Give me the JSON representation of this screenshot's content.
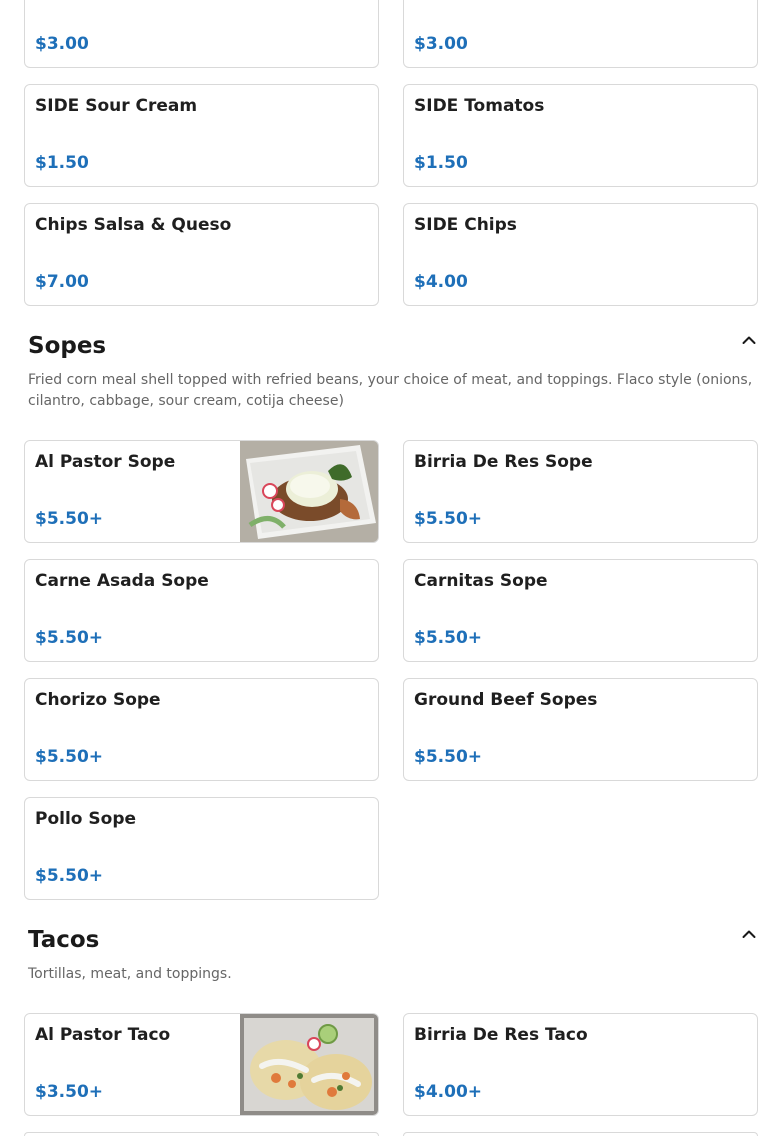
{
  "top_items": [
    {
      "name": "",
      "price": "$3.00"
    },
    {
      "name": "",
      "price": "$3.00"
    },
    {
      "name": "SIDE Sour Cream",
      "price": "$1.50"
    },
    {
      "name": "SIDE Tomatos",
      "price": "$1.50"
    },
    {
      "name": "Chips Salsa & Queso",
      "price": "$7.00"
    },
    {
      "name": "SIDE Chips",
      "price": "$4.00"
    }
  ],
  "sopes": {
    "title": "Sopes",
    "description": "Fried corn meal shell topped with refried beans, your choice of meat, and toppings. Flaco style (onions, cilantro, cabbage, sour cream, cotija cheese)",
    "items": [
      {
        "name": "Al Pastor Sope",
        "price": "$5.50+"
      },
      {
        "name": "Birria De Res Sope",
        "price": "$5.50+"
      },
      {
        "name": "Carne Asada Sope",
        "price": "$5.50+"
      },
      {
        "name": "Carnitas Sope",
        "price": "$5.50+"
      },
      {
        "name": "Chorizo Sope",
        "price": "$5.50+"
      },
      {
        "name": "Ground Beef Sopes",
        "price": "$5.50+"
      },
      {
        "name": "Pollo Sope",
        "price": "$5.50+"
      }
    ]
  },
  "tacos": {
    "title": "Tacos",
    "description": "Tortillas, meat, and toppings.",
    "items": [
      {
        "name": "Al Pastor Taco",
        "price": "$3.50+"
      },
      {
        "name": "Birria De Res Taco",
        "price": "$4.00+"
      }
    ]
  },
  "colors": {
    "price": "#1e6fb8",
    "border": "#d9d9d9",
    "heading": "#1a1a1a",
    "description": "#666666"
  },
  "icons": {
    "collapse": "chevron-up-icon"
  }
}
